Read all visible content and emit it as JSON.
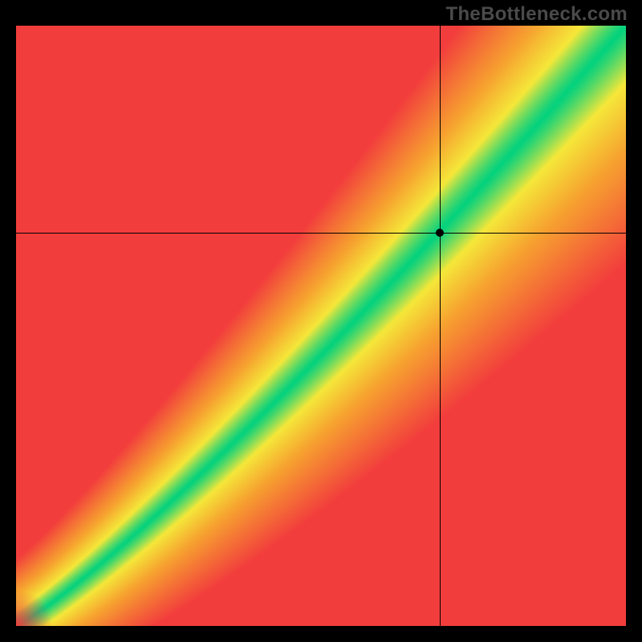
{
  "watermark": "TheBottleneck.com",
  "chart_data": {
    "type": "heatmap",
    "title": "",
    "xlabel": "",
    "ylabel": "",
    "xlim": [
      0,
      1
    ],
    "ylim": [
      0,
      1
    ],
    "grid": false,
    "legend": null,
    "description": "Diagonal green optimal band on red-yellow gradient indicating balanced pairing; crosshair marks a selected point slightly above the optimal band.",
    "crosshair": {
      "x": 0.695,
      "y": 0.655
    },
    "marker": {
      "x": 0.695,
      "y": 0.655
    },
    "band": {
      "center_slope": 0.95,
      "center_intercept": -0.03,
      "half_width": 0.075,
      "curve_power": 1.15
    },
    "colors": {
      "optimal": "#05d27e",
      "near": "#f5e83a",
      "mid": "#f7a330",
      "far": "#f23d3d"
    }
  }
}
